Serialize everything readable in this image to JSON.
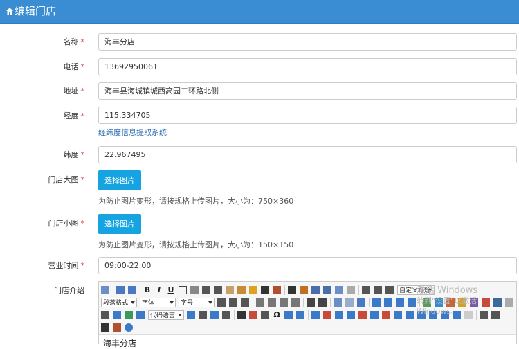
{
  "header": {
    "title": "编辑门店"
  },
  "required_mark": "*",
  "fields": {
    "name": {
      "label": "名称",
      "value": "海丰分店"
    },
    "phone": {
      "label": "电话",
      "value": "13692950061"
    },
    "address": {
      "label": "地址",
      "value": "海丰县海城镇城西高园二环路北侧"
    },
    "longitude": {
      "label": "经度",
      "value": "115.334705",
      "link": "经纬度信息提取系统"
    },
    "latitude": {
      "label": "纬度",
      "value": "22.967495"
    },
    "big_image": {
      "label": "门店大图",
      "button": "选择图片",
      "hint": "为防止图片变形，请按规格上传图片，大小为：750×360"
    },
    "small_image": {
      "label": "门店小图",
      "button": "选择图片",
      "hint": "为防止图片变形，请按规格上传图片，大小为：150×150"
    },
    "hours": {
      "label": "营业时间",
      "value": "09:00-22:00"
    },
    "intro": {
      "label": "门店介绍"
    }
  },
  "editor": {
    "selects": {
      "paragraph": "段落格式",
      "font": "字体",
      "size": "字号",
      "custom_title": "自定义标题",
      "code_lang": "代码语言"
    },
    "content": "海丰分店"
  },
  "watermark": {
    "line1": "激活 Windows",
    "line2": "转到\"设置\"以激活 Windows。"
  },
  "colors": {
    "header": "#3b8dd3",
    "button": "#16a3e1",
    "required": "#d9534f",
    "link": "#2a6fb5"
  }
}
